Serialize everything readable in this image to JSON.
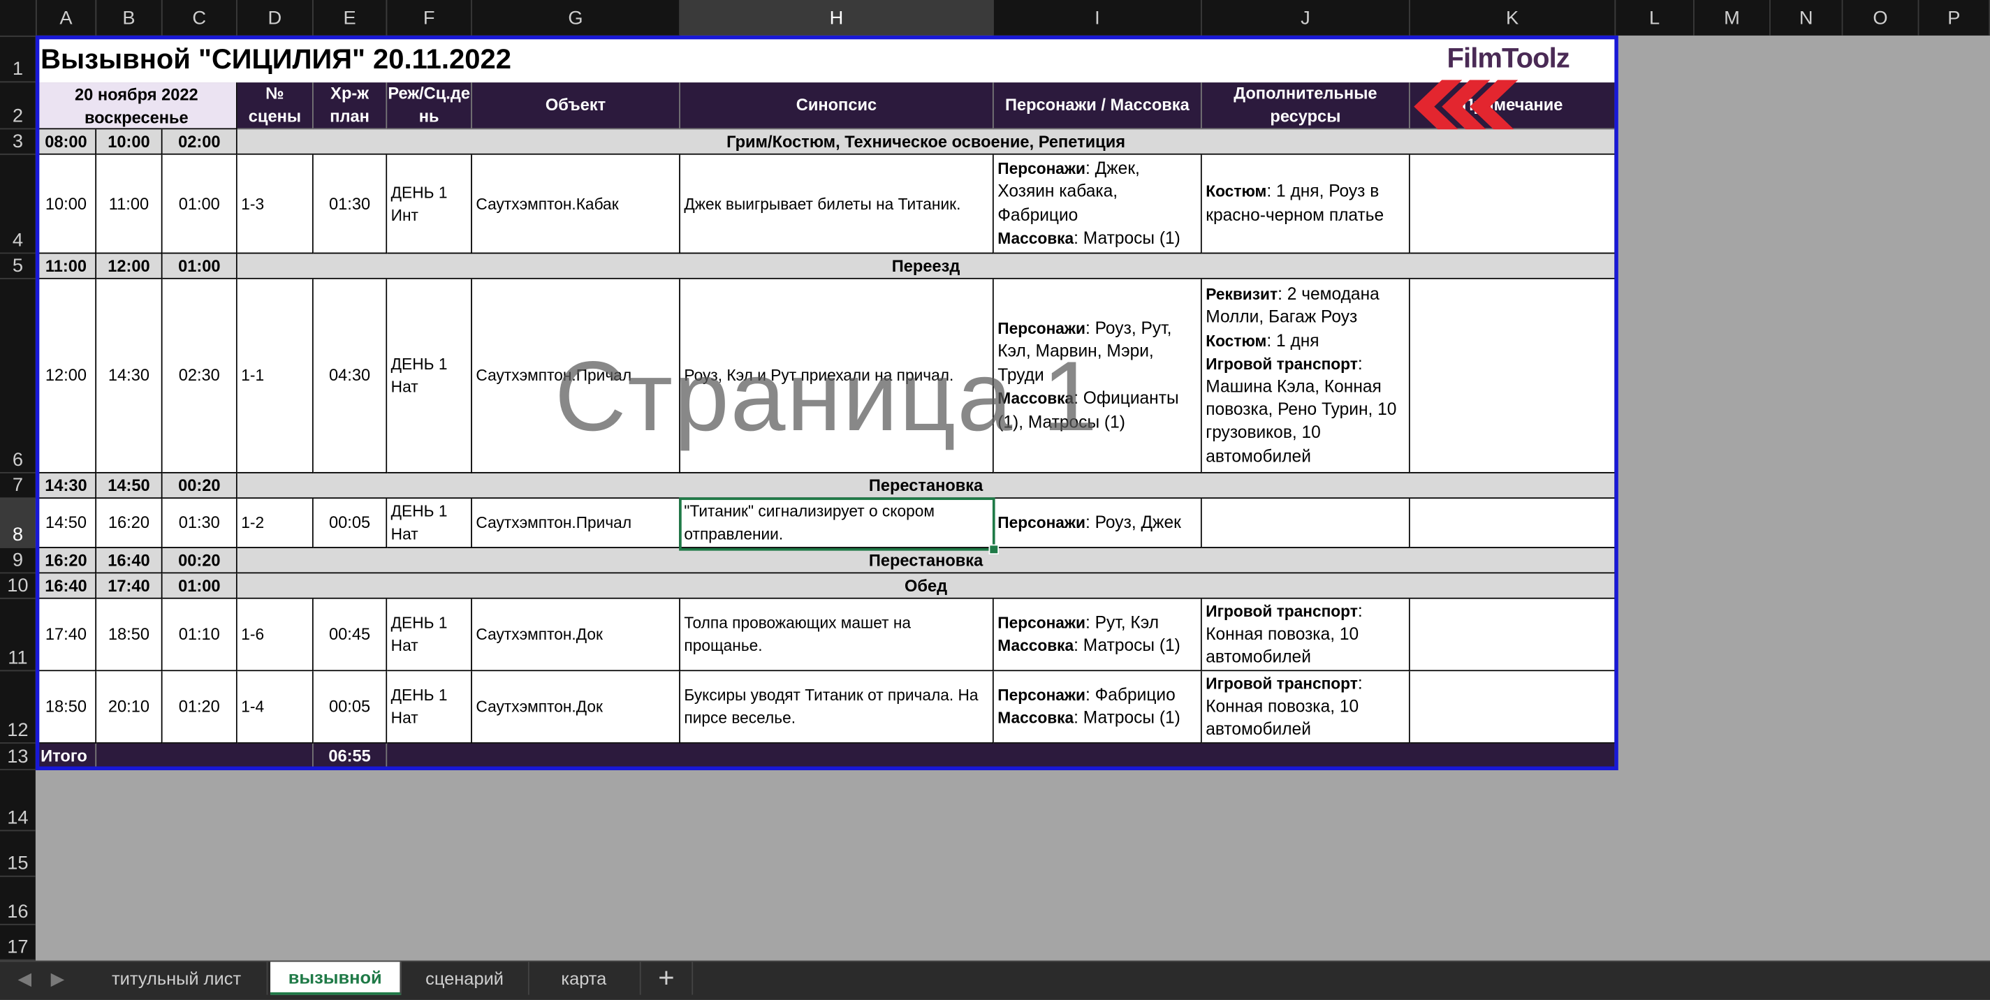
{
  "columns": [
    "A",
    "B",
    "C",
    "D",
    "E",
    "F",
    "G",
    "H",
    "I",
    "J",
    "K",
    "L",
    "M",
    "N",
    "O",
    "P"
  ],
  "rows": [
    "1",
    "2",
    "3",
    "4",
    "5",
    "6",
    "7",
    "8",
    "9",
    "10",
    "11",
    "12",
    "13",
    "14",
    "15",
    "16",
    "17"
  ],
  "title": "Вызывной \"СИЦИЛИЯ\" 20.11.2022",
  "logo": "FilmToolz",
  "watermark": "Страница 1",
  "header": {
    "date_line1": "20 ноября 2022",
    "date_line2": "воскресенье",
    "scene_no": "№\nсцены",
    "chrono_plan": "Хр-ж\nплан",
    "mode_day": "Реж/Сц.де\nнь",
    "object": "Объект",
    "synopsis": "Синопсис",
    "characters": "Персонажи / Массовка",
    "resources": "Дополнительные ресурсы",
    "note": "Примечание"
  },
  "rows_data": {
    "r3": {
      "a": "08:00",
      "b": "10:00",
      "c": "02:00",
      "label": "Грим/Костюм, Техническое освоение, Репетиция"
    },
    "r4": {
      "a": "10:00",
      "b": "11:00",
      "c": "01:00",
      "d": "1-3",
      "e": "01:30",
      "f": "ДЕНЬ 1\nИнт",
      "g": "Саутхэмптон.Кабак",
      "h": "Джек выигрывает билеты на Титаник.",
      "i_l1": "Персонажи",
      "i_v1": ": Джек, Хозяин кабака, Фабрицио",
      "i_l2": "Массовка",
      "i_v2": ": Матросы (1)",
      "j_l1": "Костюм",
      "j_v1": ": 1 дня, Роуз в красно-черном платье"
    },
    "r5": {
      "a": "11:00",
      "b": "12:00",
      "c": "01:00",
      "label": "Переезд"
    },
    "r6": {
      "a": "12:00",
      "b": "14:30",
      "c": "02:30",
      "d": "1-1",
      "e": "04:30",
      "f": "ДЕНЬ 1\nНат",
      "g": "Саутхэмптон.Причал",
      "h": "Роуз, Кэл и Рут приехали на причал.",
      "i_l1": "Персонажи",
      "i_v1": ": Роуз, Рут, Кэл, Марвин, Мэри, Труди",
      "i_l2": "Массовка",
      "i_v2": ": Официанты (1), Матросы (1)",
      "j_l1": "Реквизит",
      "j_v1": ": 2 чемодана Молли, Багаж Роуз",
      "j_l2": "Костюм",
      "j_v2": ": 1 дня",
      "j_l3": "Игровой транспорт",
      "j_v3": ":\nМашина Кэла, Конная повозка, Рено Турин, 10 грузовиков, 10 автомобилей"
    },
    "r7": {
      "a": "14:30",
      "b": "14:50",
      "c": "00:20",
      "label": "Перестановка"
    },
    "r8": {
      "a": "14:50",
      "b": "16:20",
      "c": "01:30",
      "d": "1-2",
      "e": "00:05",
      "f": "ДЕНЬ 1\nНат",
      "g": "Саутхэмптон.Причал",
      "h": "\"Титаник\" сигнализирует о скором отправлении.",
      "i_l1": "Персонажи",
      "i_v1": ": Роуз, Джек"
    },
    "r9": {
      "a": "16:20",
      "b": "16:40",
      "c": "00:20",
      "label": "Перестановка"
    },
    "r10": {
      "a": "16:40",
      "b": "17:40",
      "c": "01:00",
      "label": "Обед"
    },
    "r11": {
      "a": "17:40",
      "b": "18:50",
      "c": "01:10",
      "d": "1-6",
      "e": "00:45",
      "f": "ДЕНЬ 1\nНат",
      "g": "Саутхэмптон.Док",
      "h": "Толпа провожающих машет на прощанье.",
      "i_l1": "Персонажи",
      "i_v1": ": Рут, Кэл",
      "i_l2": "Массовка",
      "i_v2": ": Матросы (1)",
      "j_l1": "Игровой транспорт",
      "j_v1": ":\nКонная повозка, 10 автомобилей"
    },
    "r12": {
      "a": "18:50",
      "b": "20:10",
      "c": "01:20",
      "d": "1-4",
      "e": "00:05",
      "f": "ДЕНЬ 1\nНат",
      "g": "Саутхэмптон.Док",
      "h": "Буксиры уводят Титаник от причала. На пирсе веселье.",
      "i_l1": "Персонажи",
      "i_v1": ": Фабрицио",
      "i_l2": "Массовка",
      "i_v2": ": Матросы (1)",
      "j_l1": "Игровой транспорт",
      "j_v1": ":\nКонная повозка, 10 автомобилей"
    },
    "r13": {
      "a": "Итого",
      "e": "06:55"
    }
  },
  "tabs": [
    "титульный лист",
    "вызывной",
    "сценарий",
    "карта"
  ],
  "active_tab": "вызывной",
  "colors": {
    "header_dark": "#2c1a3d",
    "band_grey": "#d9d9d9",
    "date_lav": "#ebe3f2",
    "selection": "#1f7a47",
    "print_border": "#1818d6",
    "logo_arrow": "#e3262f"
  }
}
